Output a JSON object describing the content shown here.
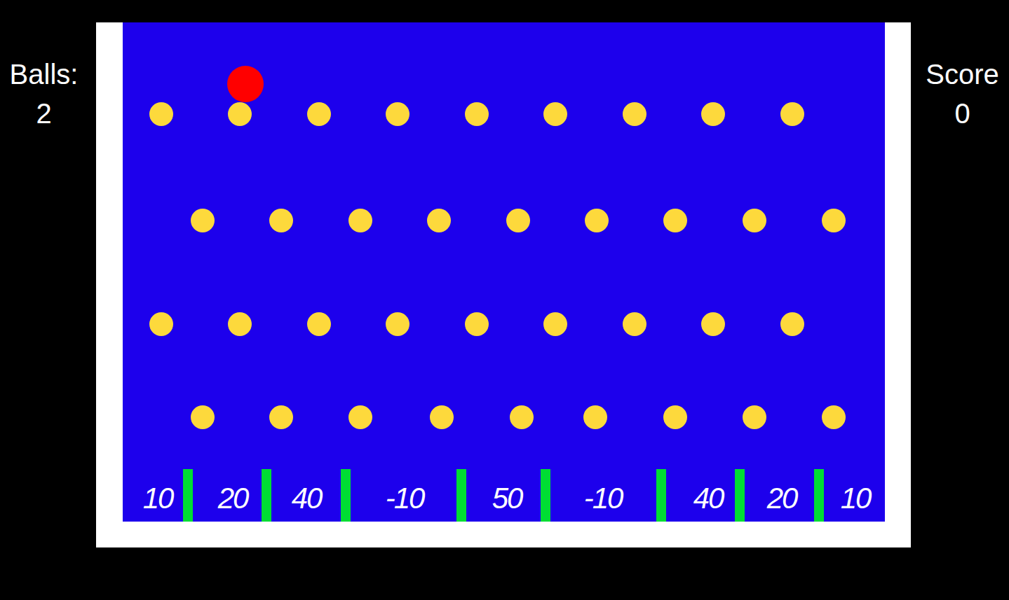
{
  "balls": {
    "label": "Balls:",
    "value": "2"
  },
  "score": {
    "label": "Score",
    "value": "0"
  },
  "slots": [
    {
      "label": "10"
    },
    {
      "label": "20"
    },
    {
      "label": "40"
    },
    {
      "label": "-10"
    },
    {
      "label": "50"
    },
    {
      "label": "-10"
    },
    {
      "label": "40"
    },
    {
      "label": "20"
    },
    {
      "label": "10"
    }
  ]
}
